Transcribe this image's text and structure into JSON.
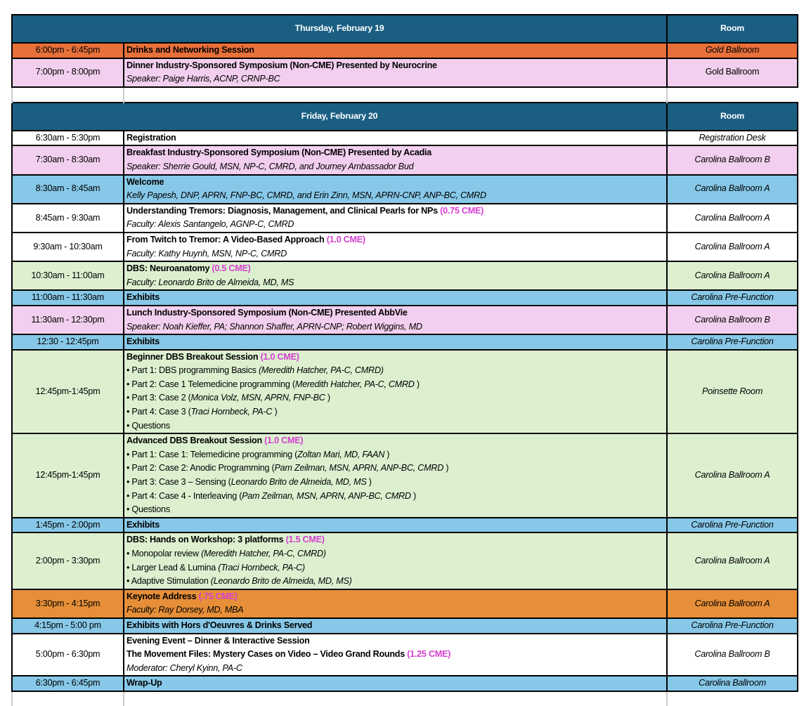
{
  "colors": {
    "header": "#1a5f82",
    "orange": "#e8703a",
    "keynote": "#e68f38",
    "pink": "#f2cfee",
    "blue": "#87c8e8",
    "green": "#dcf0d0",
    "white": "#ffffff",
    "cme": "#d63fd0"
  },
  "days": [
    {
      "title": "Thursday, February 19",
      "room_header": "Room",
      "rows": [
        {
          "time": "6:00pm - 6:45pm",
          "bg": "orange",
          "room": "Gold Ballroom",
          "room_italic": true,
          "lines": [
            [
              {
                "t": "Drinks and Networking Session",
                "s": "b"
              }
            ]
          ]
        },
        {
          "time": "7:00pm - 8:00pm",
          "bg": "pink",
          "room": "Gold Ballroom",
          "room_italic": false,
          "lines": [
            [
              {
                "t": "Dinner Industry-Sponsored Symposium (Non-CME) Presented by Neurocrine",
                "s": "b"
              }
            ],
            [
              {
                "t": "Speaker: Paige Harris, ACNP, CRNP-BC",
                "s": "i"
              }
            ]
          ]
        }
      ]
    },
    {
      "title": "Friday, February 20",
      "room_header": "Room",
      "rows": [
        {
          "time": "6:30am - 5:30pm",
          "bg": "white",
          "room": "Registration Desk",
          "room_italic": true,
          "lines": [
            [
              {
                "t": "Registration",
                "s": "b"
              }
            ]
          ]
        },
        {
          "time": "7:30am - 8:30am",
          "bg": "pink",
          "room": "Carolina Ballroom B",
          "room_italic": true,
          "lines": [
            [
              {
                "t": "Breakfast Industry-Sponsored Symposium (Non-CME) Presented by Acadia",
                "s": "b"
              }
            ],
            [
              {
                "t": "Speaker: Sherrie Gould, MSN, NP-C, CMRD, and Journey Ambassador Bud",
                "s": "i"
              }
            ]
          ]
        },
        {
          "time": "8:30am - 8:45am",
          "bg": "blue",
          "room": "Carolina Ballroom A",
          "room_italic": true,
          "lines": [
            [
              {
                "t": "Welcome",
                "s": "b"
              }
            ],
            [
              {
                "t": "Kelly Papesh, DNP, APRN, FNP-BC, CMRD, and Erin Zinn, MSN, APRN-CNP, ANP-BC, CMRD",
                "s": "i"
              }
            ]
          ]
        },
        {
          "time": "8:45am - 9:30am",
          "bg": "white",
          "room": "Carolina Ballroom A",
          "room_italic": true,
          "lines": [
            [
              {
                "t": "Understanding Tremors: Diagnosis, Management, and Clinical Pearls for NPs ",
                "s": "b"
              },
              {
                "t": "(0.75 CME)",
                "s": "cme"
              }
            ],
            [
              {
                "t": "Faculty: Alexis Santangelo, AGNP-C, CMRD",
                "s": "i"
              }
            ]
          ]
        },
        {
          "time": "9:30am - 10:30am",
          "bg": "white",
          "room": "Carolina Ballroom A",
          "room_italic": true,
          "lines": [
            [
              {
                "t": "From Twitch to Tremor: A Video-Based Approach ",
                "s": "b"
              },
              {
                "t": "(1.0 CME)",
                "s": "cme"
              }
            ],
            [
              {
                "t": "Faculty: Kathy Huynh, MSN, NP-C, CMRD",
                "s": "i"
              }
            ]
          ]
        },
        {
          "time": "10:30am - 11:00am",
          "bg": "green",
          "room": "Carolina Ballroom A",
          "room_italic": true,
          "lines": [
            [
              {
                "t": "DBS: Neuroanatomy ",
                "s": "b"
              },
              {
                "t": "(0.5 CME)",
                "s": "cme"
              }
            ],
            [
              {
                "t": "Faculty: Leonardo Brito de Almeida, MD, MS",
                "s": "i"
              }
            ]
          ]
        },
        {
          "time": "11:00am - 11:30am",
          "bg": "blue",
          "room": "Carolina Pre-Function",
          "room_italic": true,
          "lines": [
            [
              {
                "t": "Exhibits",
                "s": "b"
              }
            ]
          ]
        },
        {
          "time": "11:30am - 12:30pm",
          "bg": "pink",
          "room": "Carolina Ballroom B",
          "room_italic": true,
          "lines": [
            [
              {
                "t": "Lunch Industry-Sponsored Symposium (Non-CME) Presented AbbVie",
                "s": "b"
              }
            ],
            [
              {
                "t": "Speaker: Noah Kieffer, PA; Shannon Shaffer, APRN-CNP; Robert Wiggins, MD",
                "s": "i"
              }
            ]
          ]
        },
        {
          "time": "12:30 - 12:45pm",
          "bg": "blue",
          "room": "Carolina Pre-Function",
          "room_italic": true,
          "lines": [
            [
              {
                "t": "Exhibits",
                "s": "b"
              }
            ]
          ]
        },
        {
          "time": "12:45pm-1:45pm",
          "bg": "green",
          "room": "Poinsette Room",
          "room_italic": true,
          "lines": [
            [
              {
                "t": "Beginner DBS Breakout Session ",
                "s": "b"
              },
              {
                "t": "(1.0 CME)",
                "s": "cme"
              }
            ],
            [
              {
                "t": "• Part 1: DBS programming Basics ",
                "s": "n"
              },
              {
                "t": "(Meredith Hatcher, PA-C, CMRD)",
                "s": "i"
              }
            ],
            [
              {
                "t": "• Part 2: Case 1 Telemedicine programming (",
                "s": "n"
              },
              {
                "t": "Meredith Hatcher, PA-C, CMRD",
                "s": "i"
              },
              {
                "t": " )",
                "s": "n"
              }
            ],
            [
              {
                "t": "• Part 3: Case 2 (",
                "s": "n"
              },
              {
                "t": "Monica Volz, MSN, APRN, FNP-BC",
                "s": "i"
              },
              {
                "t": " )",
                "s": "n"
              }
            ],
            [
              {
                "t": "• Part 4: Case 3 (",
                "s": "n"
              },
              {
                "t": "Traci Hornbeck, PA-C",
                "s": "i"
              },
              {
                "t": " )",
                "s": "n"
              }
            ],
            [
              {
                "t": "• Questions",
                "s": "n"
              }
            ]
          ]
        },
        {
          "time": "12:45pm-1:45pm",
          "bg": "green",
          "room": "Carolina Ballroom A",
          "room_italic": true,
          "lines": [
            [
              {
                "t": "Advanced DBS Breakout Session ",
                "s": "b"
              },
              {
                "t": "(1.0 CME)",
                "s": "cme"
              }
            ],
            [
              {
                "t": "• Part 1: Case 1: Telemedicine programming (",
                "s": "n"
              },
              {
                "t": "Zoltan Mari, MD, FAAN",
                "s": "i"
              },
              {
                "t": " )",
                "s": "n"
              }
            ],
            [
              {
                "t": "• Part 2: Case 2: Anodic Programming (",
                "s": "n"
              },
              {
                "t": "Pam Zeilman, MSN, APRN, ANP-BC, CMRD",
                "s": "i"
              },
              {
                "t": " )",
                "s": "n"
              }
            ],
            [
              {
                "t": "• Part 3: Case 3 – Sensing (",
                "s": "n"
              },
              {
                "t": "Leonardo Brito de Almeida, MD, MS",
                "s": "i"
              },
              {
                "t": " )",
                "s": "n"
              }
            ],
            [
              {
                "t": "• Part 4: Case 4 - Interleaving (",
                "s": "n"
              },
              {
                "t": "Pam Zeilman, MSN, APRN, ANP-BC, CMRD",
                "s": "i"
              },
              {
                "t": " )",
                "s": "n"
              }
            ],
            [
              {
                "t": "• Questions",
                "s": "n"
              }
            ]
          ]
        },
        {
          "time": "1:45pm - 2:00pm",
          "bg": "blue",
          "room": "Carolina Pre-Function",
          "room_italic": true,
          "lines": [
            [
              {
                "t": "Exhibits",
                "s": "b"
              }
            ]
          ]
        },
        {
          "time": "2:00pm - 3:30pm",
          "bg": "green",
          "room": "Carolina Ballroom A",
          "room_italic": true,
          "lines": [
            [
              {
                "t": "DBS: Hands on Workshop: 3 platforms ",
                "s": "b"
              },
              {
                "t": "(1.5 CME)",
                "s": "cme"
              }
            ],
            [
              {
                "t": "• Monopolar review ",
                "s": "n"
              },
              {
                "t": "(Meredith Hatcher, PA-C, CMRD)",
                "s": "i"
              }
            ],
            [
              {
                "t": "• Larger Lead & Lumina ",
                "s": "n"
              },
              {
                "t": "(Traci Hornbeck, PA-C)",
                "s": "i"
              }
            ],
            [
              {
                "t": "• Adaptive Stimulation ",
                "s": "n"
              },
              {
                "t": "(Leonardo Brito de Almeida, MD, MS)",
                "s": "i"
              }
            ]
          ]
        },
        {
          "time": "3:30pm - 4:15pm",
          "bg": "keynote",
          "room": "Carolina Ballroom A",
          "room_italic": true,
          "lines": [
            [
              {
                "t": "Keynote Address ",
                "s": "b"
              },
              {
                "t": "(.75 CME)",
                "s": "cme"
              }
            ],
            [
              {
                "t": "Faculty: Ray Dorsey, MD, MBA",
                "s": "i"
              }
            ]
          ]
        },
        {
          "time": "4:15pm - 5:00 pm",
          "bg": "blue",
          "room": "Carolina Pre-Function",
          "room_italic": true,
          "lines": [
            [
              {
                "t": "Exhibits with Hors d'Oeuvres & Drinks Served",
                "s": "b"
              }
            ]
          ]
        },
        {
          "time": "5:00pm - 6:30pm",
          "bg": "white",
          "room": "Carolina Ballroom B",
          "room_italic": true,
          "lines": [
            [
              {
                "t": "Evening Event – Dinner & Interactive Session",
                "s": "b"
              }
            ],
            [
              {
                "t": "The Movement Files: Mystery Cases on Video – Video Grand Rounds ",
                "s": "b"
              },
              {
                "t": "(1.25 CME)",
                "s": "cme"
              }
            ],
            [
              {
                "t": "Moderator:   Cheryl Kyinn, PA-C",
                "s": "i"
              }
            ]
          ]
        },
        {
          "time": "6:30pm - 6:45pm",
          "bg": "blue",
          "room": "Carolina Ballroom",
          "room_italic": true,
          "lines": [
            [
              {
                "t": "Wrap-Up",
                "s": "b"
              }
            ]
          ]
        }
      ]
    }
  ]
}
